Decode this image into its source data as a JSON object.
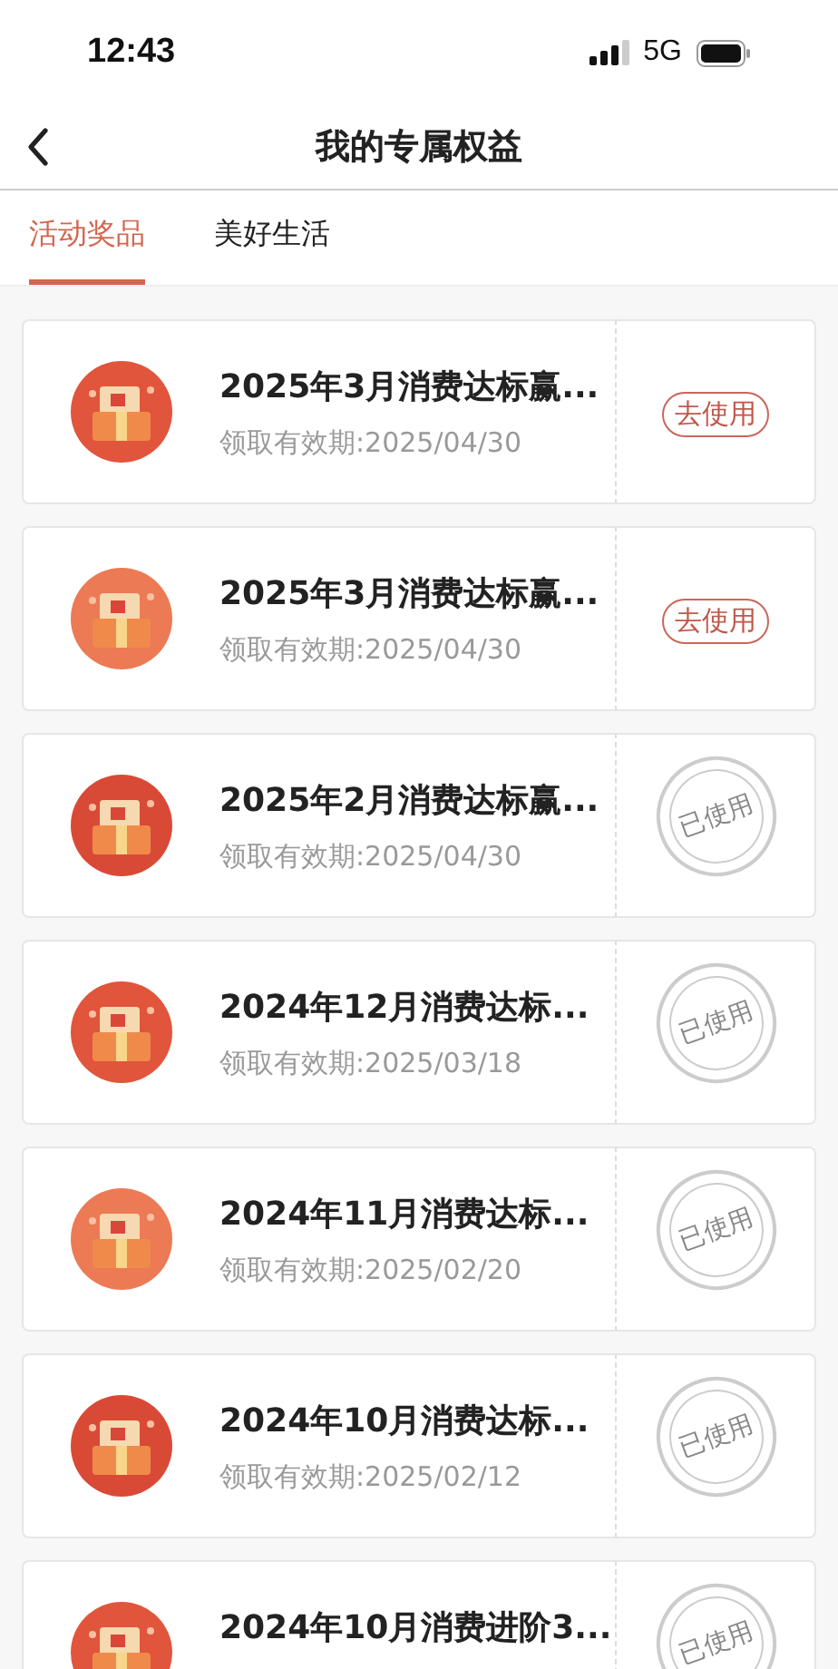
{
  "status_bar": {
    "time": "12:43",
    "network": "5G"
  },
  "nav": {
    "title": "我的专属权益"
  },
  "tabs": [
    {
      "label": "活动奖品",
      "selected": true
    },
    {
      "label": "美好生活",
      "selected": false
    }
  ],
  "rewards": [
    {
      "title": "2025年3月消费达标赢...",
      "validity": "领取有效期:2025/04/30",
      "kind": "action",
      "action": "去使用"
    },
    {
      "title": "2025年3月消费达标赢...",
      "validity": "领取有效期:2025/04/30",
      "kind": "action",
      "action": "去使用"
    },
    {
      "title": "2025年2月消费达标赢...",
      "validity": "领取有效期:2025/04/30",
      "kind": "stamp",
      "action": "已使用"
    },
    {
      "title": "2024年12月消费达标...",
      "validity": "领取有效期:2025/03/18",
      "kind": "stamp",
      "action": "已使用"
    },
    {
      "title": "2024年11月消费达标...",
      "validity": "领取有效期:2025/02/20",
      "kind": "stamp",
      "action": "已使用"
    },
    {
      "title": "2024年10月消费达标...",
      "validity": "领取有效期:2025/02/12",
      "kind": "stamp",
      "action": "已使用"
    },
    {
      "title": "2024年10月消费进阶3...",
      "kind": "stamp",
      "action": "已使用"
    }
  ]
}
